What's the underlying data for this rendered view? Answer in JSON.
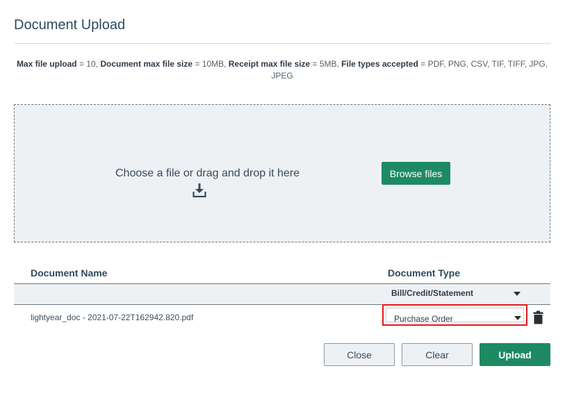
{
  "dialog": {
    "title": "Document Upload"
  },
  "limits": {
    "max_upload_label": "Max file upload",
    "max_upload_value": " = 10, ",
    "doc_size_label": "Document max file size",
    "doc_size_value": " = 10MB, ",
    "receipt_size_label": "Receipt max file size",
    "receipt_size_value": " = 5MB, ",
    "file_types_label": "File types accepted",
    "file_types_value": " = PDF, PNG, CSV, TIF, TIFF, JPG, JPEG"
  },
  "dropzone": {
    "prompt": "Choose a file or drag and drop it here",
    "browse_label": "Browse files"
  },
  "table": {
    "headers": [
      "Document Name",
      "Document Type"
    ],
    "filter_value": "Bill/Credit/Statement",
    "rows": [
      {
        "name": "lightyear_doc - 2021-07-22T162942.820.pdf",
        "type": "Purchase Order"
      }
    ]
  },
  "actions": {
    "close_label": "Close",
    "clear_label": "Clear",
    "upload_label": "Upload"
  },
  "colors": {
    "primary": "#1e8a64",
    "highlight": "#e3181e",
    "title": "#2d4a5e"
  },
  "icons": {
    "upload": "download-tray-icon",
    "delete": "trash-icon",
    "dropdown": "chevron-down-icon"
  }
}
